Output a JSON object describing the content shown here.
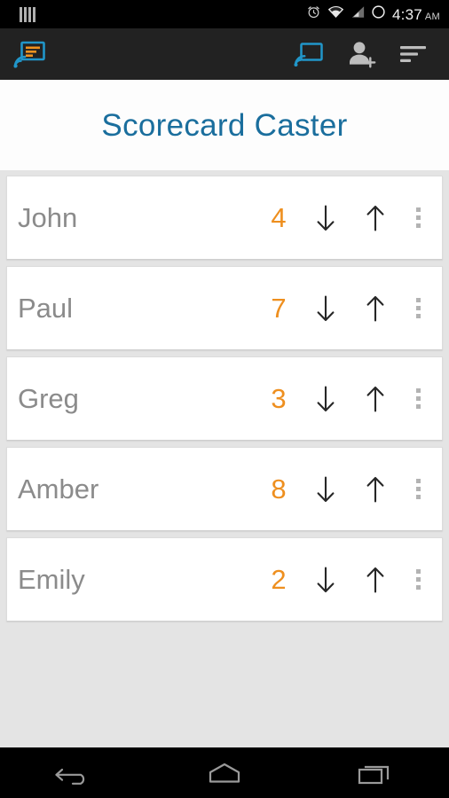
{
  "status_bar": {
    "notification_icon": "notification-bars-icon",
    "icons": [
      "alarm-icon",
      "wifi-icon",
      "cellular-signal-icon",
      "battery-circle-icon"
    ],
    "time": "4:37",
    "ampm": "AM",
    "background": "#000000"
  },
  "action_bar": {
    "app_logo": "scorecard-caster-logo-icon",
    "background": "#222222",
    "actions": [
      {
        "name": "cast-icon",
        "label": "Cast",
        "color": "#2196c9"
      },
      {
        "name": "add-person-icon",
        "label": "Add player",
        "color": "#b9b9b9"
      },
      {
        "name": "sort-icon",
        "label": "Sort",
        "color": "#b9b9b9"
      }
    ]
  },
  "header": {
    "title": "Scorecard Caster",
    "title_color": "#1a6e9d",
    "background": "#fdfdfd"
  },
  "theme": {
    "page_background": "#e4e4e4",
    "card_background": "#ffffff",
    "score_color": "#ee8f1f",
    "name_color": "#8b8b8b",
    "arrow_color": "#262626",
    "dot_color": "#b3b3b3"
  },
  "players": [
    {
      "name": "John",
      "score": "4",
      "decrement": "decrement-score-icon",
      "increment": "increment-score-icon",
      "overflow": "overflow-menu-icon"
    },
    {
      "name": "Paul",
      "score": "7",
      "decrement": "decrement-score-icon",
      "increment": "increment-score-icon",
      "overflow": "overflow-menu-icon"
    },
    {
      "name": "Greg",
      "score": "3",
      "decrement": "decrement-score-icon",
      "increment": "increment-score-icon",
      "overflow": "overflow-menu-icon"
    },
    {
      "name": "Amber",
      "score": "8",
      "decrement": "decrement-score-icon",
      "increment": "increment-score-icon",
      "overflow": "overflow-menu-icon"
    },
    {
      "name": "Emily",
      "score": "2",
      "decrement": "decrement-score-icon",
      "increment": "increment-score-icon",
      "overflow": "overflow-menu-icon"
    }
  ],
  "nav_bar": {
    "background": "#000000",
    "buttons": [
      {
        "name": "back-button",
        "label": "Back"
      },
      {
        "name": "home-button",
        "label": "Home"
      },
      {
        "name": "recents-button",
        "label": "Recent apps"
      }
    ]
  }
}
